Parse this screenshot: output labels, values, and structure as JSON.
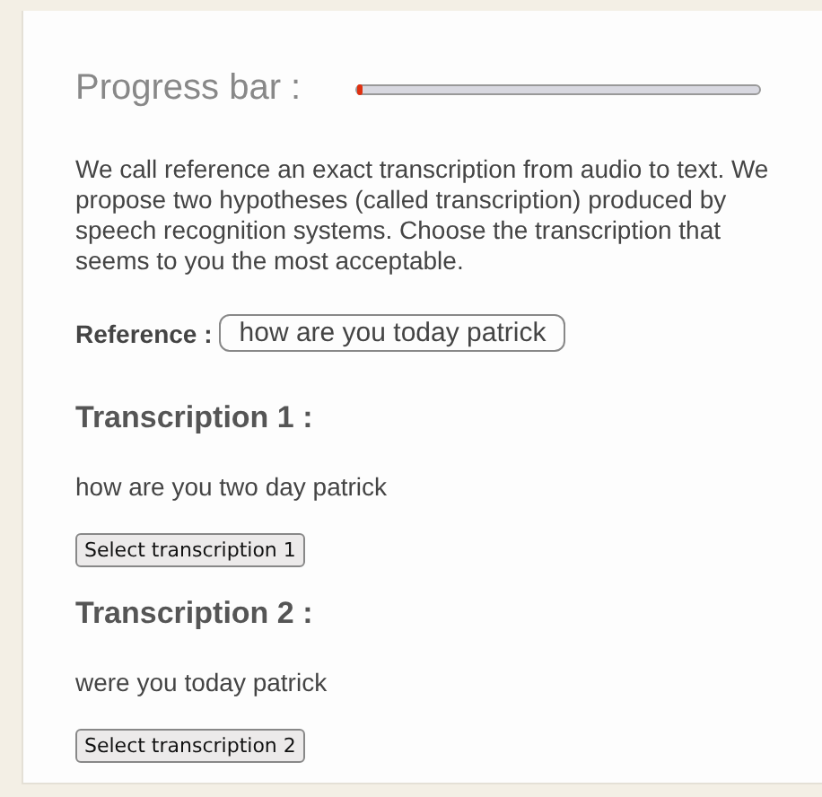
{
  "progress": {
    "label": "Progress bar :",
    "level": 0.01
  },
  "intro": "We call reference an exact transcription from audio to text. We propose two hypotheses (called transcription) produced by speech recognition systems. Choose the transcription that seems to you the most acceptable.",
  "reference": {
    "label": "Reference :",
    "value": "how are you today patrick"
  },
  "transcriptions": [
    {
      "title": "Transcription 1 :",
      "text": "how are you two day patrick",
      "button": "Select transcription 1"
    },
    {
      "title": "Transcription 2 :",
      "text": "were you today patrick",
      "button": "Select transcription 2"
    }
  ]
}
